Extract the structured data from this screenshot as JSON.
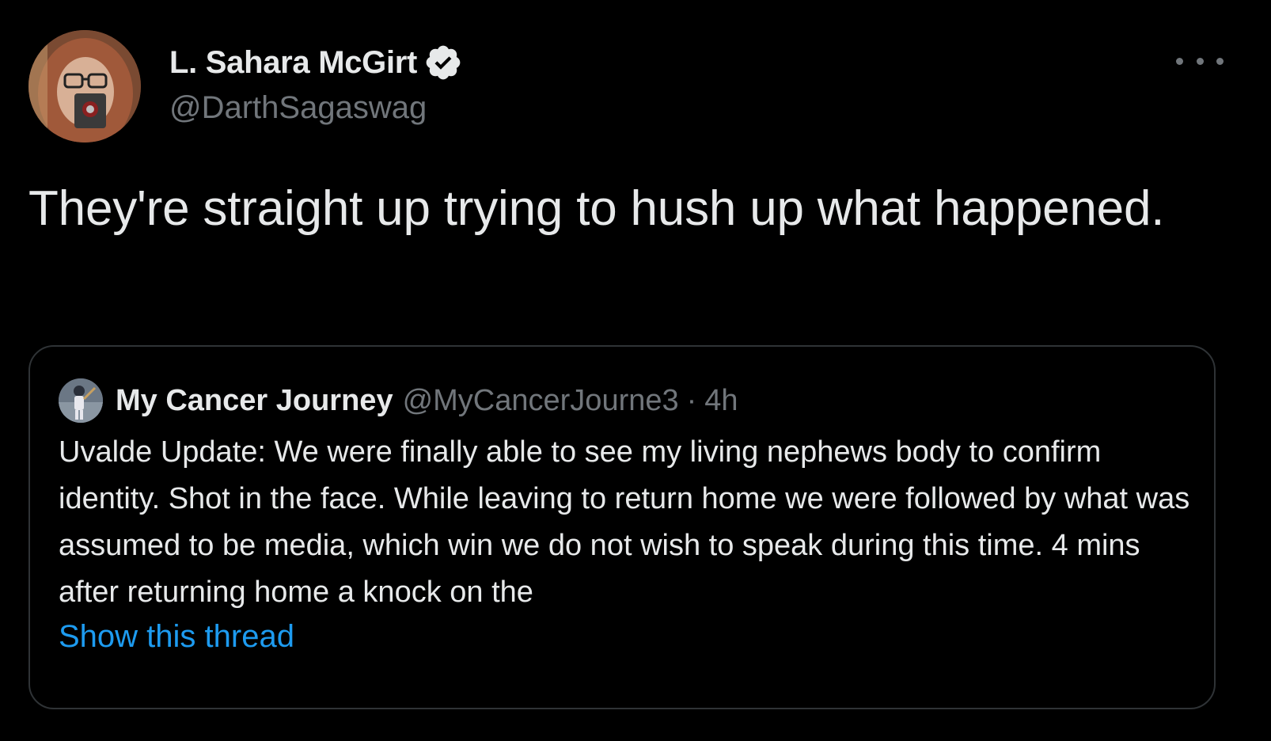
{
  "tweet": {
    "author": {
      "name": "L. Sahara McGirt",
      "handle": "@DarthSagaswag",
      "verified": true,
      "avatar_icon": "user-avatar-photo"
    },
    "more_icon": "more-horizontal-icon",
    "text": "They're straight up trying to hush up what happened.",
    "quote": {
      "author_name": "My Cancer Journey",
      "handle": "@MyCancerJourne3",
      "separator": "·",
      "time": "4h",
      "text": "Uvalde Update: We were finally able to see my living nephews body to confirm identity. Shot in the face. While leaving to return home we were followed by what was assumed to be media, which win we do not wish to speak during this time. 4 mins after returning home a knock on the",
      "show_thread_label": "Show this thread"
    }
  },
  "colors": {
    "background": "#000000",
    "primary_text": "#e7e9ea",
    "secondary_text": "#71767b",
    "link": "#1d9bf0",
    "border": "#2f3336"
  }
}
